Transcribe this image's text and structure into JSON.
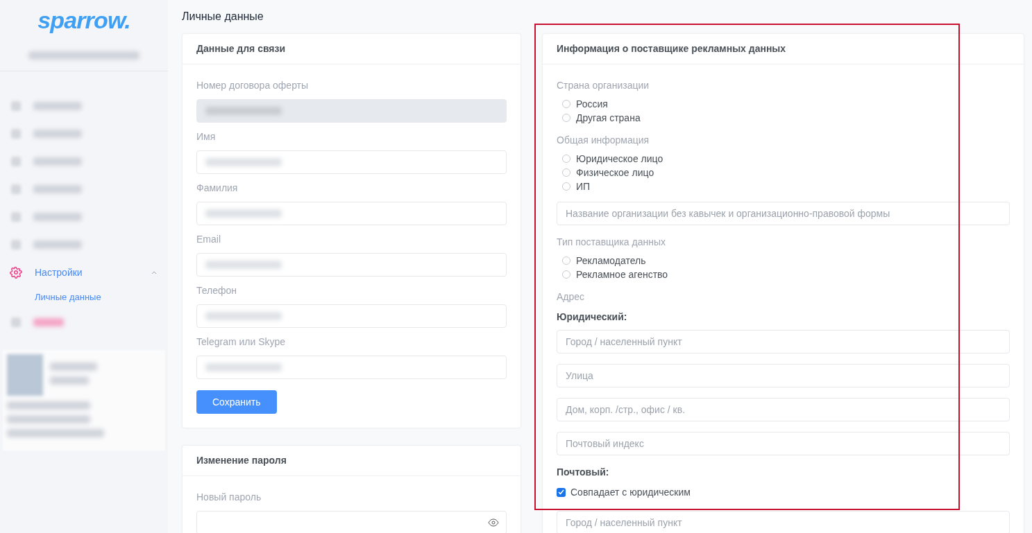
{
  "logo": "sparrow.",
  "sidebar": {
    "menu": [
      {
        "label": "Настройки",
        "expanded": true,
        "children": [
          {
            "label": "Личные данные",
            "selected": true
          }
        ]
      }
    ]
  },
  "page_title": "Личные данные",
  "contact_card": {
    "title": "Данные для связи",
    "fields": [
      {
        "label": "Номер договора оферты",
        "disabled": true
      },
      {
        "label": "Имя",
        "disabled": false
      },
      {
        "label": "Фамилия",
        "disabled": false
      },
      {
        "label": "Email",
        "disabled": false
      },
      {
        "label": "Телефон",
        "disabled": false
      },
      {
        "label": "Telegram или Skype",
        "disabled": false
      }
    ],
    "save_button": "Сохранить"
  },
  "password_card": {
    "title": "Изменение пароля",
    "fields": [
      {
        "label": "Новый пароль"
      }
    ]
  },
  "provider_card": {
    "title": "Информация о поставщике рекламных данных",
    "sections": [
      {
        "kind": "radio",
        "label": "Страна организации",
        "options": [
          {
            "label": "Россия",
            "selected": false
          },
          {
            "label": "Другая страна",
            "selected": false
          }
        ]
      },
      {
        "kind": "radio",
        "label": "Общая информация",
        "options": [
          {
            "label": "Юридическое лицо",
            "selected": false
          },
          {
            "label": "Физическое лицо",
            "selected": false
          },
          {
            "label": "ИП",
            "selected": false
          }
        ]
      },
      {
        "kind": "inputs",
        "inputs": [
          {
            "placeholder": "Название организации без кавычек и организационно-правовой формы"
          }
        ]
      },
      {
        "kind": "radio",
        "label": "Тип поставщика данных",
        "options": [
          {
            "label": "Рекламодатель",
            "selected": false
          },
          {
            "label": "Рекламное агенство",
            "selected": false
          }
        ]
      },
      {
        "kind": "caption",
        "label": "Адрес"
      },
      {
        "kind": "subheading",
        "label": "Юридический:"
      },
      {
        "kind": "inputs",
        "inputs": [
          {
            "placeholder": "Город / населенный пункт"
          },
          {
            "placeholder": "Улица"
          },
          {
            "placeholder": "Дом, корп. /стр., офис / кв."
          },
          {
            "placeholder": "Почтовый индекс"
          }
        ]
      },
      {
        "kind": "subheading",
        "label": "Почтовый:"
      },
      {
        "kind": "checkbox",
        "label": "Совпадает с юридическим",
        "checked": true
      },
      {
        "kind": "inputs",
        "inputs": [
          {
            "placeholder": "Город / населенный пункт"
          }
        ]
      }
    ]
  }
}
